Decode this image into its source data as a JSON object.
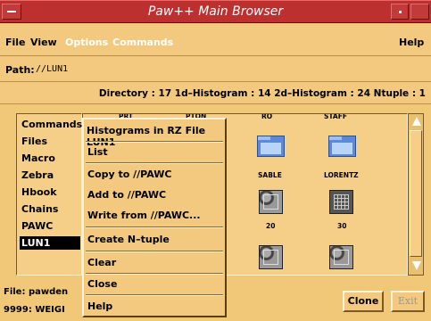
{
  "window": {
    "title": "Paw++ Main Browser"
  },
  "menubar": {
    "file": "File",
    "view": "View",
    "options": "Options",
    "commands": "Commands",
    "help": "Help"
  },
  "path": {
    "label": "Path:",
    "value": "//LUN1"
  },
  "directory": {
    "text": "Directory : 17  1d–Histogram : 14  2d–Histogram : 24  Ntuple : 1"
  },
  "list": {
    "items": [
      "Commands",
      "Files",
      "Macro",
      "Zebra",
      "Hbook",
      "Chains",
      "PAWC",
      "LUN1"
    ],
    "selected": "LUN1"
  },
  "icons": {
    "top_labels": [
      "PRT",
      "PTON",
      "RO",
      "STAFF"
    ],
    "row1": [
      "SABLE",
      "LORENTZ"
    ],
    "row2": [
      "20",
      "30"
    ]
  },
  "popup": {
    "title": "Histograms in RZ File LUN1",
    "items": [
      "List",
      "Copy to //PAWC",
      "Add to //PAWC",
      "Write from //PAWC...",
      "Create N–tuple",
      "Clear",
      "Close",
      "Help"
    ]
  },
  "status": {
    "line1": "File: pawden",
    "line2": "9999: WEIGI"
  },
  "buttons": {
    "clone": "Clone",
    "exit": "Exit"
  },
  "colors": {
    "titlebar": "#bc3030",
    "background": "#f2c97e",
    "folder": "#5a8ad8"
  }
}
